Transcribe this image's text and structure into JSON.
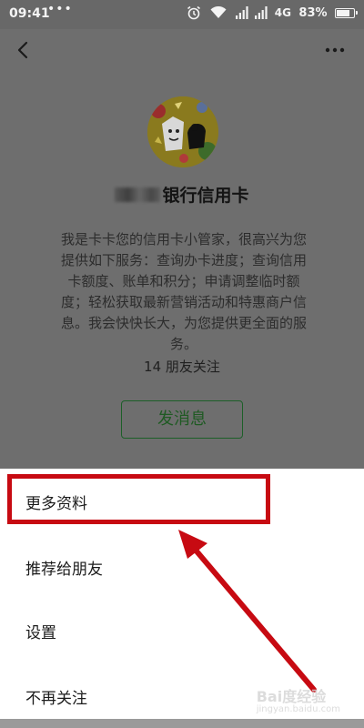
{
  "status_bar": {
    "time": "09:41",
    "dots": "•••",
    "network": "4G",
    "battery": "83%",
    "battery_level": 0.83,
    "icons": [
      "alarm-icon",
      "wifi-icon",
      "signal-icon",
      "battery-icon"
    ]
  },
  "header": {
    "back_icon": "chevron-left-icon",
    "more_icon": "more-dots-icon"
  },
  "profile": {
    "name_suffix": "银行信用卡",
    "description": "我是卡卡您的信用卡小管家，很高兴为您提供如下服务：查询办卡进度；查询信用卡额度、账单和积分；申请调整临时额度；轻松获取最新营销活动和特惠商户信息。我会快快长大，为您提供更全面的服务。",
    "follower_count": "14",
    "follower_label": "朋友关注",
    "send_message_label": "发消息"
  },
  "action_sheet": {
    "items": [
      {
        "label": "更多资料"
      },
      {
        "label": "推荐给朋友"
      },
      {
        "label": "设置"
      },
      {
        "label": "不再关注"
      }
    ],
    "highlight_color": "#c70a12"
  },
  "watermark": {
    "text": "Bai度经验",
    "sub": "jingyan.baidu.com"
  }
}
